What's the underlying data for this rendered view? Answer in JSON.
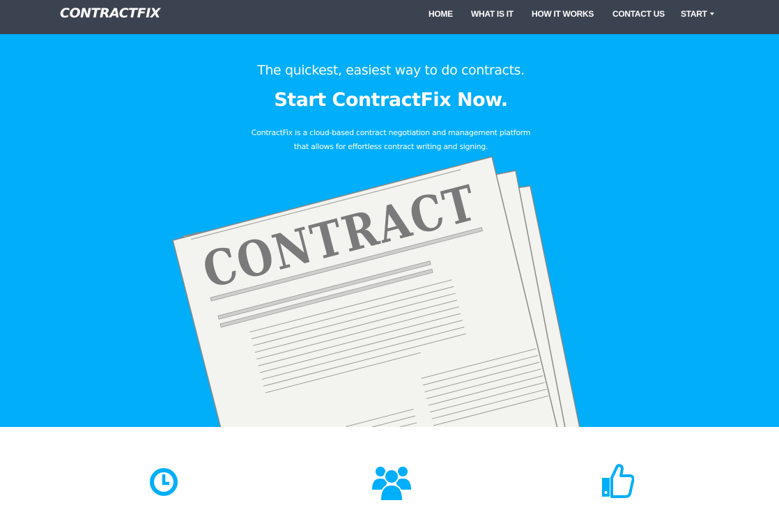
{
  "navbar": {
    "brand": "CONTRACTFIX",
    "links": [
      "HOME",
      "WHAT IS IT",
      "HOW IT WORKS",
      "CONTACT US",
      "START"
    ]
  },
  "hero": {
    "tagline": "The quickest, easiest way to do contracts.",
    "headline": "Start ContractFix Now.",
    "description_lines": [
      "ContractFix is a cloud-based contract negotiation and management platform",
      "that allows for effortless contract writing and signing."
    ],
    "illustration_text": "CONTRACT"
  },
  "features": {
    "icons": [
      "clock-icon",
      "users-icon",
      "thumbs-up-icon"
    ]
  },
  "colors": {
    "navbar": "#3c4350",
    "hero": "#00aef9",
    "accent": "#00aef9",
    "paper": "#f3f3ef"
  }
}
